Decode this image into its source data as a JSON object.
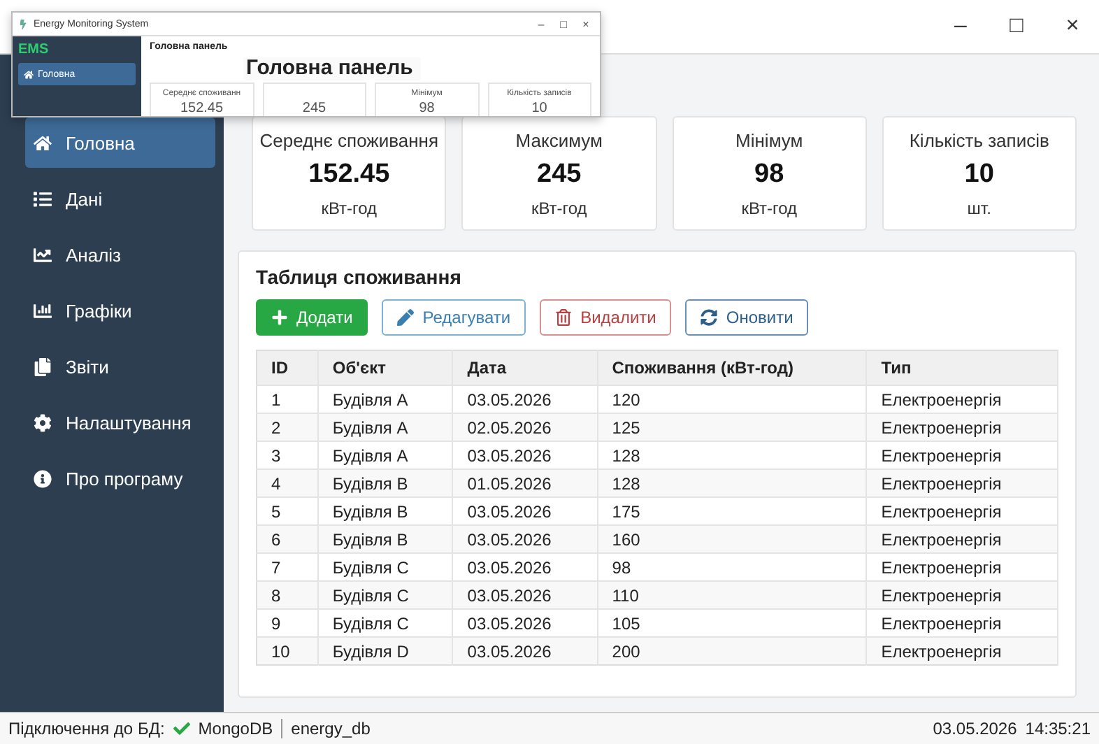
{
  "inset_window": {
    "title": "Energy Monitoring System",
    "controls": [
      "–",
      "□",
      "×"
    ],
    "brand": "EMS",
    "nav_item": {
      "label": "Головна",
      "selected": true
    },
    "header": "Головна панель",
    "cards": [
      {
        "label": "Середнє споживанн",
        "value": "152.45"
      },
      {
        "value": "245"
      },
      {
        "label": "Мінімум",
        "value": "98"
      },
      {
        "label": "Кількість записів",
        "value": "10"
      }
    ]
  },
  "window": {
    "controls": [
      "–",
      "□",
      "×"
    ]
  },
  "sidebar": {
    "items": [
      {
        "label": "Головна",
        "kind": "home",
        "selected": true
      },
      {
        "label": "Дані",
        "kind": "list",
        "selected": false
      },
      {
        "label": "Аналіз",
        "kind": "trend",
        "selected": false
      },
      {
        "label": "Графіки",
        "kind": "bars",
        "selected": false
      },
      {
        "label": "Звіти",
        "kind": "reports",
        "selected": false
      },
      {
        "label": "Налаштування",
        "kind": "settings",
        "selected": false
      },
      {
        "label": "Про програму",
        "kind": "info",
        "selected": false
      }
    ]
  },
  "page_title": "Головна панель",
  "stats": [
    {
      "label": "Середнє споживання",
      "value": "152.45",
      "unit": "кВт-год"
    },
    {
      "label": "Максимум",
      "value": "245",
      "unit": "кВт-год"
    },
    {
      "label": "Мінімум",
      "value": "98",
      "unit": "кВт-год"
    },
    {
      "label": "Кількість записів",
      "value": "10",
      "unit": "шт."
    }
  ],
  "table_panel": {
    "title": "Таблиця споживання",
    "buttons": [
      {
        "label": "Додати",
        "kind": "add"
      },
      {
        "label": "Редагувати",
        "kind": "edit"
      },
      {
        "label": "Видалити",
        "kind": "delete"
      },
      {
        "label": "Оновити",
        "kind": "refresh"
      }
    ],
    "columns": [
      "ID",
      "Об'єкт",
      "Дата",
      "Споживання (кВт-год)",
      "Тип"
    ],
    "rows": [
      [
        "1",
        "Будівля A",
        "03.05.2026",
        "120",
        "Електроенергія"
      ],
      [
        "2",
        "Будівля A",
        "02.05.2026",
        "125",
        "Електроенергія"
      ],
      [
        "3",
        "Будівля A",
        "03.05.2026",
        "128",
        "Електроенергія"
      ],
      [
        "4",
        "Будівля B",
        "01.05.2026",
        "128",
        "Електроенергія"
      ],
      [
        "5",
        "Будівля B",
        "03.05.2026",
        "175",
        "Електроенергія"
      ],
      [
        "6",
        "Будівля B",
        "03.05.2026",
        "160",
        "Електроенергія"
      ],
      [
        "7",
        "Будівля C",
        "03.05.2026",
        "98",
        "Електроенергія"
      ],
      [
        "8",
        "Будівля C",
        "03.05.2026",
        "110",
        "Електроенергія"
      ],
      [
        "9",
        "Будівля C",
        "03.05.2026",
        "105",
        "Електроенергія"
      ],
      [
        "10",
        "Будівля D",
        "03.05.2026",
        "200",
        "Електроенергія"
      ]
    ]
  },
  "status_bar": {
    "label": "Підключення до БД:",
    "connected": true,
    "db_type": "MongoDB",
    "db_name": "energy_db",
    "date": "03.05.2026",
    "time": "14:35:21"
  }
}
